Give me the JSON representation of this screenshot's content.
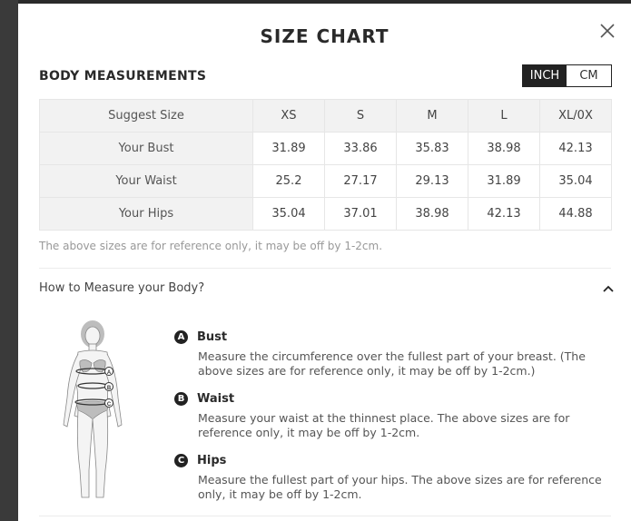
{
  "modal": {
    "title": "SIZE CHART",
    "close_icon": "close-icon"
  },
  "body_measurements": {
    "title": "BODY MEASUREMENTS",
    "units": [
      "INCH",
      "CM"
    ],
    "active_unit": "INCH"
  },
  "table": {
    "header": {
      "label": "Suggest Size",
      "sizes": [
        "XS",
        "S",
        "M",
        "L",
        "XL/0X"
      ]
    },
    "rows": [
      {
        "label": "Your Bust",
        "values": [
          "31.89",
          "33.86",
          "35.83",
          "38.98",
          "42.13"
        ]
      },
      {
        "label": "Your Waist",
        "values": [
          "25.2",
          "27.17",
          "29.13",
          "31.89",
          "35.04"
        ]
      },
      {
        "label": "Your Hips",
        "values": [
          "35.04",
          "37.01",
          "38.98",
          "42.13",
          "44.88"
        ]
      }
    ]
  },
  "note": "The above sizes are for reference only, it may be off by 1-2cm.",
  "how_to": {
    "label": "How to Measure your Body?",
    "chevron_icon": "chevron-up-icon",
    "figure_icon": "body-figure-icon",
    "figure_markers": [
      "A",
      "B",
      "C"
    ],
    "items": [
      {
        "badge": "A",
        "title": "Bust",
        "desc": "Measure the circumference over the fullest part of your breast. (The above sizes are for reference only, it may be off by 1-2cm.)"
      },
      {
        "badge": "B",
        "title": "Waist",
        "desc": "Measure your waist at the thinnest place. The above sizes are for reference only, it may be off by 1-2cm."
      },
      {
        "badge": "C",
        "title": "Hips",
        "desc": "Measure the fullest part of your hips. The above sizes are for reference only, it may be off by 1-2cm."
      }
    ]
  }
}
